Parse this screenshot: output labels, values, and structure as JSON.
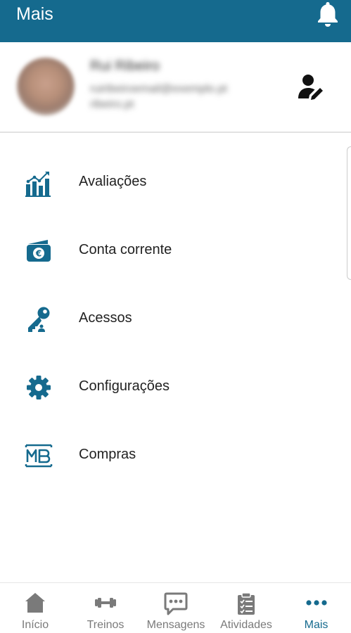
{
  "header": {
    "title": "Mais",
    "notification_icon": "bell-icon"
  },
  "profile": {
    "name": "Rui Ribeiro",
    "email_line1": "ruiribeiroemail@exemplo.pt",
    "email_line2": "ribeiro.pt",
    "edit_icon": "user-edit-icon"
  },
  "menu": {
    "items": [
      {
        "label": "Avaliações",
        "icon": "chart-icon"
      },
      {
        "label": "Conta corrente",
        "icon": "wallet-icon"
      },
      {
        "label": "Acessos",
        "icon": "key-icon"
      },
      {
        "label": "Configurações",
        "icon": "gear-icon"
      },
      {
        "label": "Compras",
        "icon": "multibanco-icon"
      }
    ]
  },
  "bottom_nav": {
    "items": [
      {
        "label": "Início",
        "icon": "home-icon",
        "active": false
      },
      {
        "label": "Treinos",
        "icon": "dumbbell-icon",
        "active": false
      },
      {
        "label": "Mensagens",
        "icon": "chat-icon",
        "active": false
      },
      {
        "label": "Atividades",
        "icon": "clipboard-icon",
        "active": false
      },
      {
        "label": "Mais",
        "icon": "more-icon",
        "active": true
      }
    ]
  },
  "colors": {
    "primary": "#156a8e",
    "inactive": "#7a7a7a",
    "text": "#222222"
  }
}
